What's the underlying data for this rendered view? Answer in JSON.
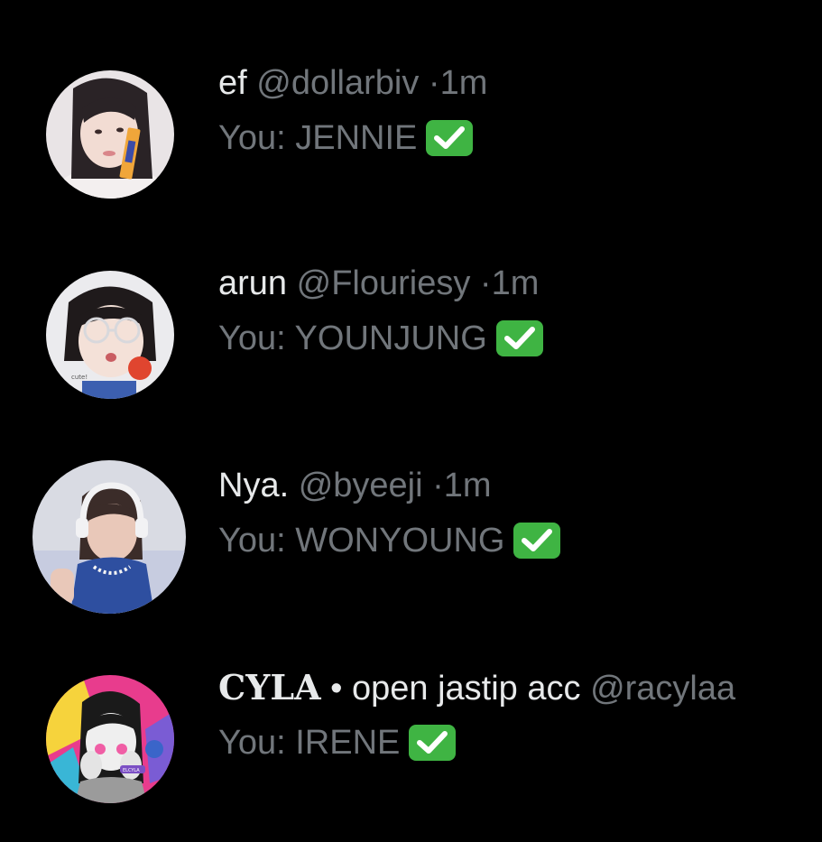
{
  "conversations": [
    {
      "display_name": "ef",
      "handle": "@dollarbiv",
      "separator": "·",
      "time": "1m",
      "preview": "You: JENNIE",
      "status_icon": "check-mark-button-emoji",
      "avatar_icon": "avatar-photo"
    },
    {
      "display_name": "arun",
      "handle": "@Flouriesy",
      "separator": "·",
      "time": "1m",
      "preview": "You: YOUNJUNG",
      "status_icon": "check-mark-button-emoji",
      "avatar_icon": "avatar-photo"
    },
    {
      "display_name": "Nya.",
      "handle": "@byeeji",
      "separator": "·",
      "time": "1m",
      "preview": "You: WONYOUNG",
      "status_icon": "check-mark-button-emoji",
      "avatar_icon": "avatar-photo"
    },
    {
      "display_name_styled": "CYLA",
      "display_name_rest": "• open jastip acc",
      "handle": "@racylaa",
      "preview": "You: IRENE",
      "status_icon": "check-mark-button-emoji",
      "avatar_icon": "avatar-photo"
    }
  ],
  "colors": {
    "background": "#000000",
    "primary_text": "#e7e9ea",
    "secondary_text": "#71767b",
    "check_green": "#3fb443"
  }
}
